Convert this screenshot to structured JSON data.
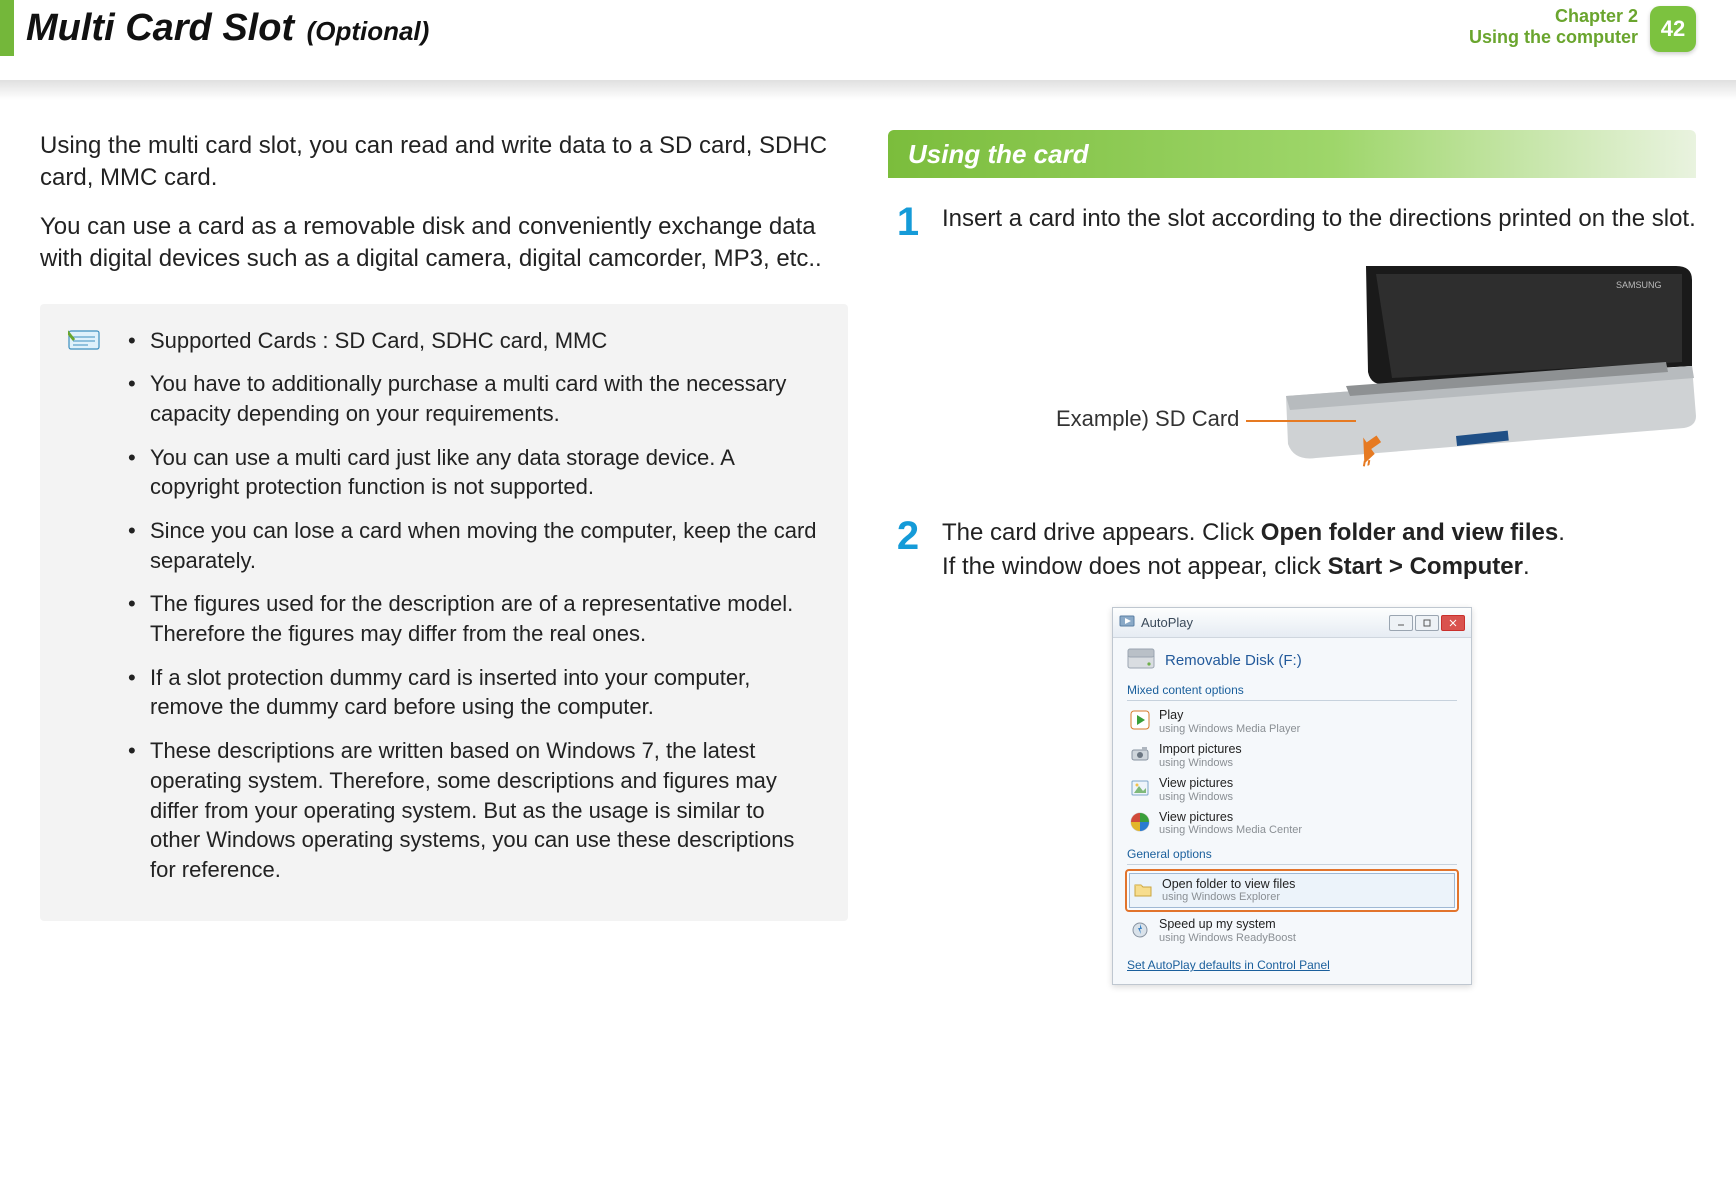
{
  "header": {
    "title_main": "Multi Card Slot",
    "title_optional": "(Optional)",
    "chapter_label": "Chapter 2",
    "chapter_sub": "Using the computer",
    "page_number": "42"
  },
  "intro": {
    "p1": "Using the multi card slot, you can read and write data to a SD card, SDHC card, MMC card.",
    "p2": "You can use a card as a removable disk and conveniently exchange data with digital devices such as a digital camera, digital camcorder, MP3, etc.."
  },
  "notes": {
    "items": [
      "Supported Cards : SD Card, SDHC card, MMC",
      "You have to additionally purchase a multi card with the necessary capacity depending on your requirements.",
      "You can use a multi card just like any data storage device. A copyright protection function is not supported.",
      "Since you can lose a card when moving the computer, keep the card separately.",
      "The figures used for the description are of a representative model. Therefore the figures may differ from the real ones.",
      "If a slot protection dummy card is inserted into your computer, remove the dummy card before using the computer.",
      "These descriptions are written based on Windows 7, the latest operating system. Therefore, some descriptions and figures may differ from your operating system. But as the usage is similar to other Windows operating systems, you can use these descriptions for reference."
    ]
  },
  "section": {
    "title": "Using the card"
  },
  "steps": {
    "s1": {
      "num": "1",
      "text": "Insert a card into the slot according to the directions printed on the slot."
    },
    "s2": {
      "num": "2",
      "line1_pre": "The card drive appears. Click ",
      "line1_bold": "Open folder and view files",
      "line1_post": ".",
      "line2_pre": "If the window does not appear, click ",
      "line2_bold": "Start > Computer",
      "line2_post": "."
    }
  },
  "figure": {
    "example_label": "Example) SD Card"
  },
  "autoplay": {
    "window_title": "AutoPlay",
    "drive_label": "Removable Disk (F:)",
    "group1": "Mixed content options",
    "options": [
      {
        "t1": "Play",
        "t2": "using Windows Media Player"
      },
      {
        "t1": "Import pictures",
        "t2": "using Windows"
      },
      {
        "t1": "View pictures",
        "t2": "using Windows"
      },
      {
        "t1": "View pictures",
        "t2": "using Windows Media Center"
      }
    ],
    "group2": "General options",
    "highlight": {
      "t1": "Open folder to view files",
      "t2": "using Windows Explorer"
    },
    "option_after": {
      "t1": "Speed up my system",
      "t2": "using Windows ReadyBoost"
    },
    "link": "Set AutoPlay defaults in Control Panel"
  }
}
